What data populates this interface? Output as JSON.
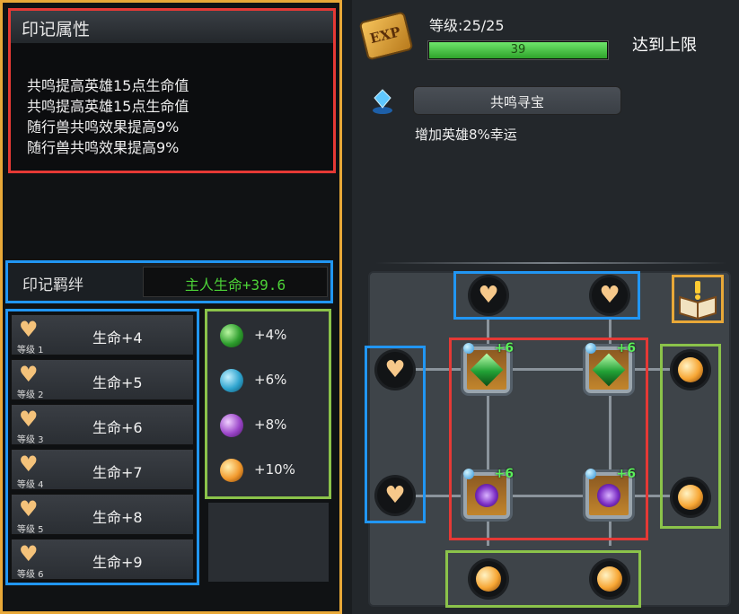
{
  "left": {
    "attr_title": "印记属性",
    "attr_lines": [
      "共鸣提高英雄15点生命值",
      "共鸣提高英雄15点生命值",
      "随行兽共鸣效果提高9%",
      "随行兽共鸣效果提高9%"
    ],
    "bond_label": "印记羁绊",
    "bond_value": "主人生命+39.6",
    "levels": [
      {
        "level": "等级 1",
        "life": "生命+4"
      },
      {
        "level": "等级 2",
        "life": "生命+5"
      },
      {
        "level": "等级 3",
        "life": "生命+6"
      },
      {
        "level": "等级 4",
        "life": "生命+7"
      },
      {
        "level": "等级 5",
        "life": "生命+8"
      },
      {
        "level": "等级 6",
        "life": "生命+9"
      }
    ],
    "bonuses": [
      {
        "orb": "green-orb",
        "text": "+4%"
      },
      {
        "orb": "blue-orb",
        "text": "+6%"
      },
      {
        "orb": "purple-orb",
        "text": "+8%"
      },
      {
        "orb": "orange-orb",
        "text": "+10%"
      }
    ]
  },
  "right": {
    "exp_badge": "EXP",
    "level_text": "等级:25/25",
    "exp_value": "39",
    "exp_fill_fraction": 1.0,
    "max_text": "达到上限",
    "treasure_label": "共鸣寻宝",
    "luck_text": "增加英雄8%幸运",
    "gem_plus": "+6"
  },
  "colors": {
    "highlight_orange": "#e8a838",
    "highlight_red": "#e53935",
    "highlight_blue": "#2196f3",
    "highlight_green": "#8bc34a",
    "bond_value_green": "#4cd137",
    "exp_bar_green": "#2ea32a"
  }
}
